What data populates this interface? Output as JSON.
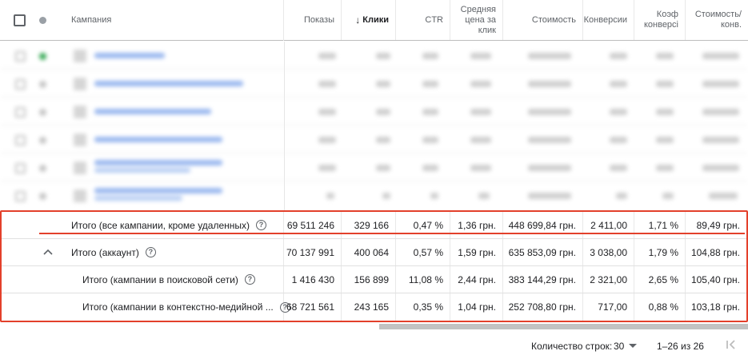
{
  "header": {
    "campaign": "Кампания",
    "impressions": "Показы",
    "clicks": "Клики",
    "ctr": "CTR",
    "avg_cpc_lines": [
      "Средняя",
      "цена за",
      "клик"
    ],
    "cost": "Стоимость",
    "conversions": "Конверсии",
    "conv_rate_lines": [
      "Коэф",
      "конверсі"
    ],
    "cost_per_conv_lines": [
      "Стоимость/",
      "конв."
    ]
  },
  "totals": [
    {
      "label": "Итого (все кампании, кроме удаленных)",
      "impressions": "69 511 246",
      "clicks": "329 166",
      "ctr": "0,47 %",
      "avg_cpc": "1,36 грн.",
      "cost": "448 699,84 грн.",
      "conversions": "2 411,00",
      "conv_rate": "1,71 %",
      "cost_per_conv": "89,49 грн."
    },
    {
      "label": "Итого (аккаунт)",
      "impressions": "70 137 991",
      "clicks": "400 064",
      "ctr": "0,57 %",
      "avg_cpc": "1,59 грн.",
      "cost": "635 853,09 грн.",
      "conversions": "3 038,00",
      "conv_rate": "1,79 %",
      "cost_per_conv": "104,88 грн."
    },
    {
      "label": "Итого (кампании в поисковой сети)",
      "impressions": "1 416 430",
      "clicks": "156 899",
      "ctr": "11,08 %",
      "avg_cpc": "2,44 грн.",
      "cost": "383 144,29 грн.",
      "conversions": "2 321,00",
      "conv_rate": "2,65 %",
      "cost_per_conv": "105,40 грн."
    },
    {
      "label": "Итого (кампании в контекстно-медийной ...",
      "impressions": "68 721 561",
      "clicks": "243 165",
      "ctr": "0,35 %",
      "avg_cpc": "1,04 грн.",
      "cost": "252 708,80 грн.",
      "conversions": "717,00",
      "conv_rate": "0,88 %",
      "cost_per_conv": "103,18 грн."
    }
  ],
  "footer": {
    "rows_label": "Количество строк:",
    "rows_value": "30",
    "range": "1–26 из 26"
  },
  "icons": {
    "help": "help-circle-icon",
    "chevron": "chevron-up-icon",
    "sort": "arrow-down-icon",
    "first_page": "first-page-icon"
  },
  "colors": {
    "highlight": "#e3402b",
    "link_blurred": "#9ab8ef",
    "status_enabled": "#34a853"
  }
}
